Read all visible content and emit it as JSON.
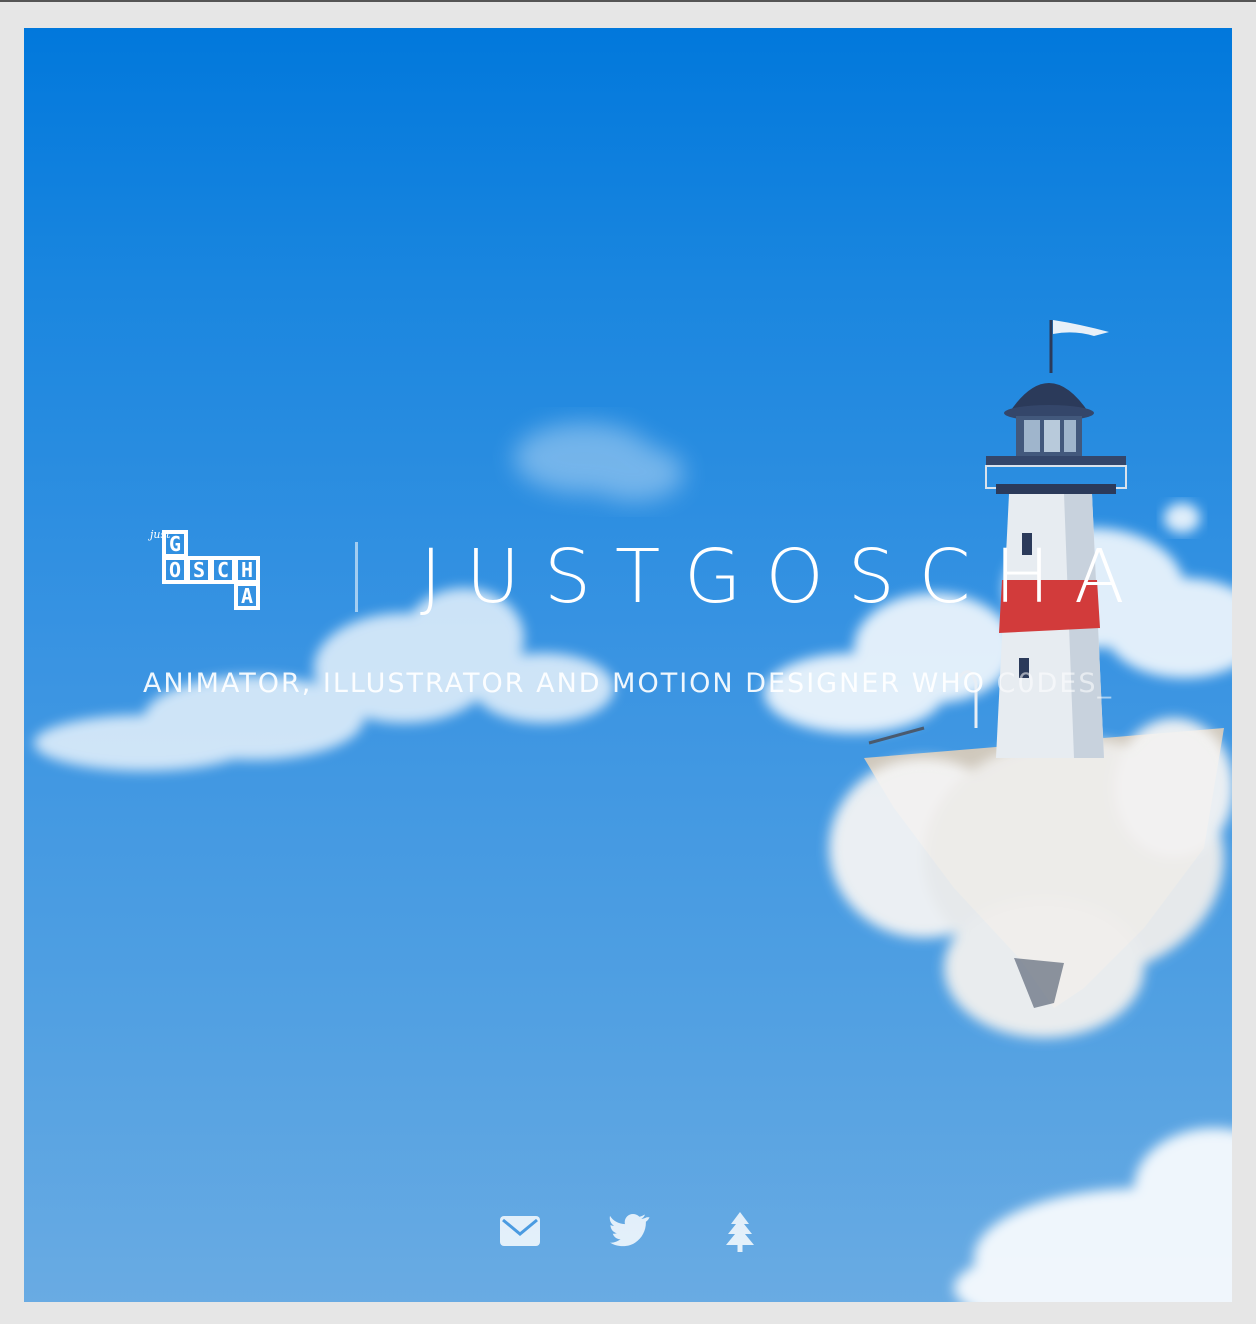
{
  "brand": {
    "logo_text_small": "just",
    "logo_letters": [
      "G",
      "O",
      "S",
      "C",
      "H",
      "A"
    ],
    "title": "JUSTGOSCHA"
  },
  "tagline": {
    "text": "ANIMATOR, ILLUSTRATOR AND MOTION DESIGNER WHO ",
    "typed": "C0DES_"
  },
  "socials": [
    {
      "icon": "mail-icon"
    },
    {
      "icon": "twitter-icon"
    },
    {
      "icon": "tree-icon"
    }
  ],
  "colors": {
    "sky_top": "#0178dc",
    "sky_bottom": "#69abe3",
    "text": "#ffffff",
    "lighthouse_band": "#d83a3a",
    "lighthouse_roof": "#2b3a5a"
  }
}
